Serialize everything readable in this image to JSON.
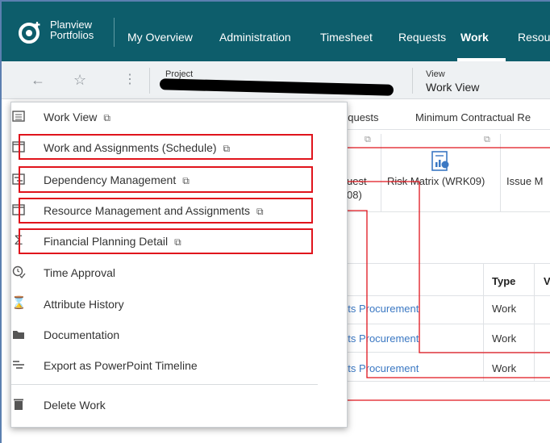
{
  "brand": {
    "line1": "Planview",
    "line2": "Portfolios"
  },
  "nav": {
    "items": [
      "My Overview",
      "Administration",
      "Timesheet",
      "Requests",
      "Work",
      "Resou"
    ],
    "active": "Work"
  },
  "subbar": {
    "project_label": "Project",
    "view_label": "View",
    "view_value": "Work View"
  },
  "background": {
    "tabs": [
      "equests",
      "Minimum Contractual Re"
    ],
    "tiles": [
      "uest",
      "08)",
      "Risk Matrix (WRK09)",
      "Issue M"
    ],
    "table": {
      "headers": [
        "Type",
        "V"
      ],
      "rows": [
        {
          "name": "nts Procurement",
          "type": "Work"
        },
        {
          "name": "nts Procurement",
          "type": "Work"
        },
        {
          "name": "nts Procurement",
          "type": "Work"
        }
      ]
    }
  },
  "menu": {
    "items": [
      {
        "label": "Work View",
        "icon": "list-view-icon",
        "external": true
      },
      {
        "label": "Work and Assignments (Schedule)",
        "icon": "window-icon",
        "external": true
      },
      {
        "label": "Dependency Management",
        "icon": "dependency-icon",
        "external": true
      },
      {
        "label": "Resource Management and Assignments",
        "icon": "window-icon",
        "external": true
      },
      {
        "label": "Financial Planning Detail",
        "icon": "sigma-icon",
        "external": true
      },
      {
        "label": "Time Approval",
        "icon": "clock-check-icon",
        "external": false
      },
      {
        "label": "Attribute History",
        "icon": "hourglass-icon",
        "external": false
      },
      {
        "label": "Documentation",
        "icon": "folder-icon",
        "external": false
      },
      {
        "label": "Export as PowerPoint Timeline",
        "icon": "timeline-icon",
        "external": false
      },
      {
        "label": "Delete Work",
        "icon": "trash-icon",
        "external": false
      }
    ]
  },
  "colors": {
    "nav_bg": "#0d5d6b",
    "highlight": "#e0141c",
    "link": "#3b78c3"
  }
}
